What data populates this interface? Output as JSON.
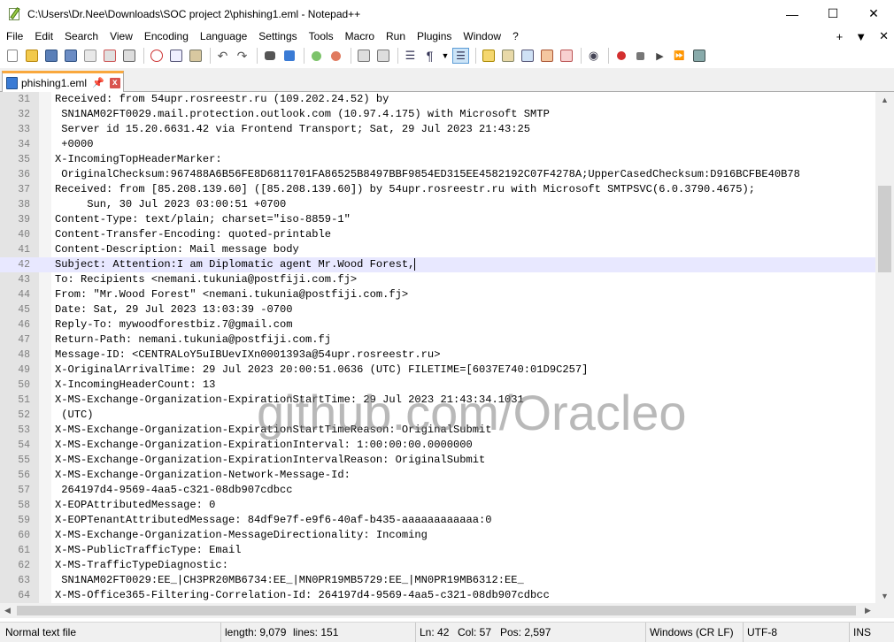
{
  "window": {
    "title": "C:\\Users\\Dr.Nee\\Downloads\\SOC project 2\\phishing1.eml - Notepad++",
    "minimize": "—",
    "maximize": "☐",
    "close": "✕"
  },
  "menu": {
    "items": [
      "File",
      "Edit",
      "Search",
      "View",
      "Encoding",
      "Language",
      "Settings",
      "Tools",
      "Macro",
      "Run",
      "Plugins",
      "Window",
      "?"
    ],
    "right": [
      "+",
      "▼",
      "✕"
    ]
  },
  "tab": {
    "label": "phishing1.eml",
    "pin": "📌",
    "close": "x"
  },
  "editor": {
    "current_line": 42,
    "lines": [
      {
        "n": "31",
        "t": "Received: from 54upr.rosreestr.ru (109.202.24.52) by"
      },
      {
        "n": "32",
        "t": " SN1NAM02FT0029.mail.protection.outlook.com (10.97.4.175) with Microsoft SMTP"
      },
      {
        "n": "33",
        "t": " Server id 15.20.6631.42 via Frontend Transport; Sat, 29 Jul 2023 21:43:25"
      },
      {
        "n": "34",
        "t": " +0000"
      },
      {
        "n": "35",
        "t": "X-IncomingTopHeaderMarker:"
      },
      {
        "n": "36",
        "t": " OriginalChecksum:967488A6B56FE8D6811701FA86525B8497BBF9854ED315EE4582192C07F4278A;UpperCasedChecksum:D916BCFBE40B78"
      },
      {
        "n": "37",
        "t": "Received: from [85.208.139.60] ([85.208.139.60]) by 54upr.rosreestr.ru with Microsoft SMTPSVC(6.0.3790.4675);"
      },
      {
        "n": "38",
        "t": "     Sun, 30 Jul 2023 03:00:51 +0700"
      },
      {
        "n": "39",
        "t": "Content-Type: text/plain; charset=\"iso-8859-1\""
      },
      {
        "n": "40",
        "t": "Content-Transfer-Encoding: quoted-printable"
      },
      {
        "n": "41",
        "t": "Content-Description: Mail message body"
      },
      {
        "n": "42",
        "t": "Subject: Attention:I am Diplomatic agent Mr.Wood Forest,"
      },
      {
        "n": "43",
        "t": "To: Recipients <nemani.tukunia@postfiji.com.fj>"
      },
      {
        "n": "44",
        "t": "From: \"Mr.Wood Forest\" <nemani.tukunia@postfiji.com.fj>"
      },
      {
        "n": "45",
        "t": "Date: Sat, 29 Jul 2023 13:03:39 -0700"
      },
      {
        "n": "46",
        "t": "Reply-To: mywoodforestbiz.7@gmail.com"
      },
      {
        "n": "47",
        "t": "Return-Path: nemani.tukunia@postfiji.com.fj"
      },
      {
        "n": "48",
        "t": "Message-ID: <CENTRALoY5uIBUevIXn0001393a@54upr.rosreestr.ru>"
      },
      {
        "n": "49",
        "t": "X-OriginalArrivalTime: 29 Jul 2023 20:00:51.0636 (UTC) FILETIME=[6037E740:01D9C257]"
      },
      {
        "n": "50",
        "t": "X-IncomingHeaderCount: 13"
      },
      {
        "n": "51",
        "t": "X-MS-Exchange-Organization-ExpirationStartTime: 29 Jul 2023 21:43:34.1031"
      },
      {
        "n": "52",
        "t": " (UTC)"
      },
      {
        "n": "53",
        "t": "X-MS-Exchange-Organization-ExpirationStartTimeReason: OriginalSubmit"
      },
      {
        "n": "54",
        "t": "X-MS-Exchange-Organization-ExpirationInterval: 1:00:00:00.0000000"
      },
      {
        "n": "55",
        "t": "X-MS-Exchange-Organization-ExpirationIntervalReason: OriginalSubmit"
      },
      {
        "n": "56",
        "t": "X-MS-Exchange-Organization-Network-Message-Id:"
      },
      {
        "n": "57",
        "t": " 264197d4-9569-4aa5-c321-08db907cdbcc"
      },
      {
        "n": "58",
        "t": "X-EOPAttributedMessage: 0"
      },
      {
        "n": "59",
        "t": "X-EOPTenantAttributedMessage: 84df9e7f-e9f6-40af-b435-aaaaaaaaaaaa:0"
      },
      {
        "n": "60",
        "t": "X-MS-Exchange-Organization-MessageDirectionality: Incoming"
      },
      {
        "n": "61",
        "t": "X-MS-PublicTrafficType: Email"
      },
      {
        "n": "62",
        "t": "X-MS-TrafficTypeDiagnostic:"
      },
      {
        "n": "63",
        "t": " SN1NAM02FT0029:EE_|CH3PR20MB6734:EE_|MN0PR19MB5729:EE_|MN0PR19MB6312:EE_"
      },
      {
        "n": "64",
        "t": "X-MS-Office365-Filtering-Correlation-Id: 264197d4-9569-4aa5-c321-08db907cdbcc"
      }
    ]
  },
  "watermark": "github.com/Oracleo",
  "status": {
    "file_type": "Normal text file",
    "length": "length: 9,079",
    "lines": "lines: 151",
    "ln": "Ln: 42",
    "col": "Col: 57",
    "pos": "Pos: 2,597",
    "eol": "Windows (CR LF)",
    "encoding": "UTF-8",
    "mode": "INS"
  }
}
